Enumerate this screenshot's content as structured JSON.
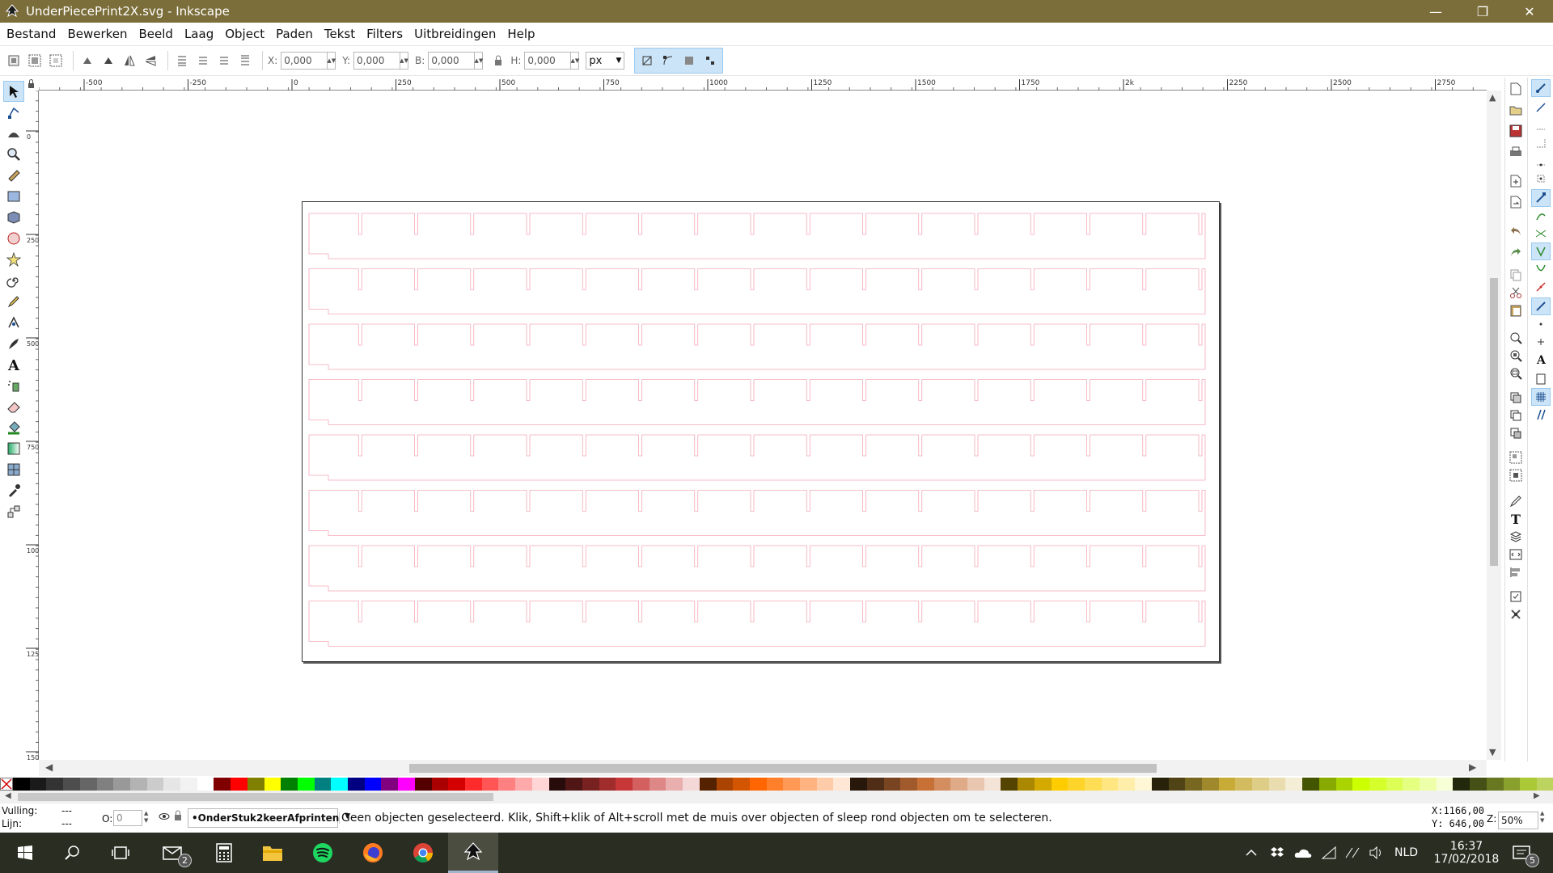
{
  "window": {
    "title": "UnderPiecePrint2X.svg - Inkscape",
    "minimize": "—",
    "maximize": "❐",
    "close": "✕"
  },
  "menu": [
    "Bestand",
    "Bewerken",
    "Beeld",
    "Laag",
    "Object",
    "Paden",
    "Tekst",
    "Filters",
    "Uitbreidingen",
    "Help"
  ],
  "toolcontrols": {
    "x_label": "X:",
    "x_value": "0,000",
    "y_label": "Y:",
    "y_value": "0,000",
    "w_label": "B:",
    "w_value": "0,000",
    "h_label": "H:",
    "h_value": "0,000",
    "unit": "px"
  },
  "ruler": {
    "h_ticks": [
      "-500",
      "-250",
      "0",
      "250",
      "500",
      "750",
      "1000",
      "1250",
      "1500",
      "1750",
      "2k",
      "2250",
      "2500",
      "2750"
    ],
    "v_ticks": [
      "0",
      "250",
      "500",
      "750",
      "1000",
      "1250",
      "1500"
    ]
  },
  "drawing": {
    "stroke_color": "#f5a9b8",
    "rows": 8,
    "cols": 16
  },
  "palette": {
    "colors": [
      "#000000",
      "#1a1a1a",
      "#333333",
      "#4d4d4d",
      "#666666",
      "#808080",
      "#999999",
      "#b3b3b3",
      "#cccccc",
      "#e6e6e6",
      "#f2f2f2",
      "#ffffff",
      "#800000",
      "#ff0000",
      "#808000",
      "#ffff00",
      "#008000",
      "#00ff00",
      "#008080",
      "#00ffff",
      "#000080",
      "#0000ff",
      "#800080",
      "#ff00ff",
      "#550000",
      "#aa0000",
      "#d40000",
      "#ff2a2a",
      "#ff5555",
      "#ff8080",
      "#ffaaaa",
      "#ffd5d5",
      "#280b0b",
      "#501616",
      "#782121",
      "#a02c2c",
      "#c83737",
      "#d35f5f",
      "#de8787",
      "#e9afaf",
      "#f4d7d7",
      "#552200",
      "#aa4400",
      "#d45500",
      "#ff6600",
      "#ff7f2a",
      "#ff9955",
      "#ffb380",
      "#ffccaa",
      "#ffe6d5",
      "#28170b",
      "#502d16",
      "#784421",
      "#a05a2c",
      "#c87137",
      "#d38d5f",
      "#deaa87",
      "#e9c6af",
      "#f4e3d7",
      "#554400",
      "#aa8800",
      "#d4aa00",
      "#ffcc00",
      "#ffd42a",
      "#ffdd55",
      "#ffe680",
      "#ffeeaa",
      "#fff6d5",
      "#28220b",
      "#504416",
      "#786721",
      "#a0892c",
      "#c8ab37",
      "#d3bc5f",
      "#decd87",
      "#e9ddaf",
      "#f4eed7",
      "#445500",
      "#88aa00",
      "#aad400",
      "#ccff00",
      "#d4ff2a",
      "#ddff55",
      "#e5ff80",
      "#eeffaa",
      "#f6ffd5",
      "#22280b",
      "#445016",
      "#677821",
      "#89a02c",
      "#abc837",
      "#bcd35f"
    ]
  },
  "status": {
    "fill_label": "Vulling:",
    "fill_value": "---",
    "stroke_label": "Lijn:",
    "stroke_value": "---",
    "opacity_label": "O:",
    "opacity_value": "0",
    "layer": "•OnderStuk2keerAfprinten",
    "message": "Geen objecten geselecteerd. Klik, Shift+klik of Alt+scroll met de muis over objecten of sleep rond objecten om te selecteren.",
    "cursor_x": "X:1166,00",
    "cursor_y": "Y: 646,00",
    "zoom_label": "Z:",
    "zoom": "50%"
  },
  "taskbar": {
    "mail_badge": "2",
    "lang": "NLD",
    "time": "16:37",
    "date": "17/02/2018",
    "notif": "5"
  }
}
